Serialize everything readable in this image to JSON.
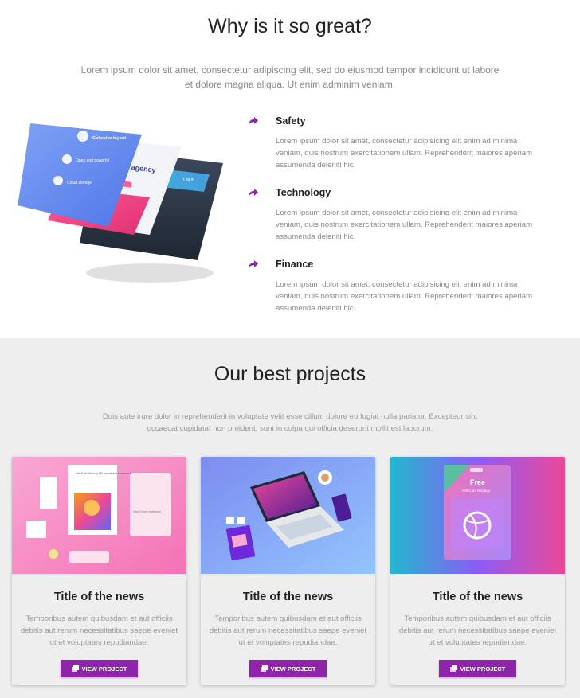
{
  "great": {
    "title": "Why is it so great?",
    "lead": "Lorem ipsum dolor sit amet, consectetur adipiscing elit, sed do eiusmod tempor incididunt ut labore et dolore magna aliqua. Ut enim adminim veniam.",
    "mockup": {
      "card_heading": "Cohesive layout",
      "card_item_1": "Open and powerful",
      "card_item_2": "Cloud storage",
      "agency_text": "ve agency",
      "log_in": "Log in"
    },
    "features": [
      {
        "icon": "share-arrow-icon",
        "title": "Safety",
        "text": "Lorem ipsum dolor sit amet, consectetur adipisicing elit enim ad minima veniam, quis nostrum exercitationem ullam. Reprehenderit maiores aperiam assumenda deleniti hic."
      },
      {
        "icon": "share-arrow-icon",
        "title": "Technology",
        "text": "Lorem ipsum dolor sit amet, consectetur adipisicing elit enim ad minima veniam, quis nostrum exercitationem ullam. Reprehenderit maiores aperiam assumenda deleniti hic."
      },
      {
        "icon": "share-arrow-icon",
        "title": "Finance",
        "text": "Lorem ipsum dolor sit amet, consectetur adipisicing elit enim ad minima veniam, quis nostrum exercitationem ullam. Reprehenderit maiores aperiam assumenda deleniti hic."
      }
    ]
  },
  "projects": {
    "title": "Our best projects",
    "lead": "Duis aute irure dolor in reprehenderit in voluptate velit esse cillum dolore eu fugiat nulla pariatur. Excepteur sint occaecat cupidatat non proident, sunt in culpa qui officia deserunt mollit est laborum.",
    "cards": [
      {
        "title": "Title of the news",
        "text": "Temporibus autem quibusdam et aut officiis debitis aut rerum necessitatibus saepe eveniet ut et voluptates repudiandae.",
        "button": "VIEW PROJECT",
        "brochure_text": "Half Fold Mockup US format and resource Brochure Template",
        "notebook_text": "Hard Cover Notebook"
      },
      {
        "title": "Title of the news",
        "text": "Temporibus autem quibusdam et aut officiis debitis aut rerum necessitatibus saepe eveniet ut et voluptates repudiandae.",
        "button": "VIEW PROJECT"
      },
      {
        "title": "Title of the news",
        "text": "Temporibus autem quibusdam et aut officiis debitis aut rerum necessitatibus saepe eveniet ut et voluptates repudiandae.",
        "button": "VIEW PROJECT",
        "gift_title": "Free",
        "gift_sub": "Gift Card Mockup"
      }
    ]
  },
  "colors": {
    "accent": "#8e24aa",
    "section_bg": "#eeeeee",
    "heading": "#212121",
    "muted_text": "#8a8a8a"
  }
}
